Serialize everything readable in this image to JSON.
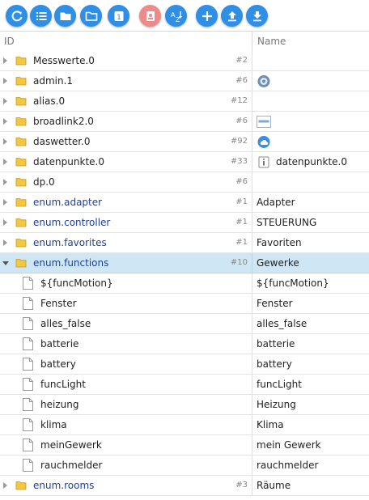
{
  "toolbar": {
    "buttons": [
      {
        "icon": "refresh-icon"
      },
      {
        "icon": "list-icon"
      },
      {
        "icon": "folder-icon"
      },
      {
        "icon": "folder-outline-icon"
      },
      {
        "icon": "counter-icon",
        "label": "1"
      },
      {
        "icon": "role-badge-icon"
      },
      {
        "icon": "sort-az-icon"
      },
      {
        "icon": "add-icon"
      },
      {
        "icon": "upload-icon"
      },
      {
        "icon": "download-icon"
      }
    ]
  },
  "header": {
    "id_label": "ID",
    "name_label": "Name"
  },
  "rows": [
    {
      "id": "Messwerte.0",
      "count": "#2",
      "name": ""
    },
    {
      "id": "admin.1",
      "count": "#6",
      "name": "",
      "name_icon": "admin-adapter-icon"
    },
    {
      "id": "alias.0",
      "count": "#12",
      "name": ""
    },
    {
      "id": "broadlink2.0",
      "count": "#6",
      "name": "",
      "name_icon": "broadlink-adapter-icon"
    },
    {
      "id": "daswetter.0",
      "count": "#92",
      "name": "",
      "name_icon": "weather-adapter-icon"
    },
    {
      "id": "datenpunkte.0",
      "count": "#33",
      "name": "datenpunkte.0",
      "name_icon": "info-adapter-icon"
    },
    {
      "id": "dp.0",
      "count": "#6",
      "name": ""
    },
    {
      "id": "enum.adapter",
      "count": "#1",
      "name": "Adapter"
    },
    {
      "id": "enum.controller",
      "count": "#1",
      "name": "STEUERUNG"
    },
    {
      "id": "enum.favorites",
      "count": "#1",
      "name": "Favoriten"
    },
    {
      "id": "enum.functions",
      "count": "#10",
      "name": "Gewerke",
      "selected": true,
      "expanded": true
    },
    {
      "id": "${funcMotion}",
      "name": "${funcMotion}"
    },
    {
      "id": "Fenster",
      "name": "Fenster"
    },
    {
      "id": "alles_false",
      "name": "alles_false"
    },
    {
      "id": "batterie",
      "name": "batterie"
    },
    {
      "id": "battery",
      "name": "battery"
    },
    {
      "id": "funcLight",
      "name": "funcLight"
    },
    {
      "id": "heizung",
      "name": "Heizung"
    },
    {
      "id": "klima",
      "name": "Klima"
    },
    {
      "id": "meinGewerk",
      "name": "mein Gewerk"
    },
    {
      "id": "rauchmelder",
      "name": "rauchmelder"
    },
    {
      "id": "enum.rooms",
      "count": "#3",
      "name": "Räume"
    }
  ],
  "colors": {
    "accent": "#2f8fe6",
    "selected_row": "#cfe7f5",
    "enum_text": "#1d3f9a",
    "folder": "#f2c744"
  }
}
